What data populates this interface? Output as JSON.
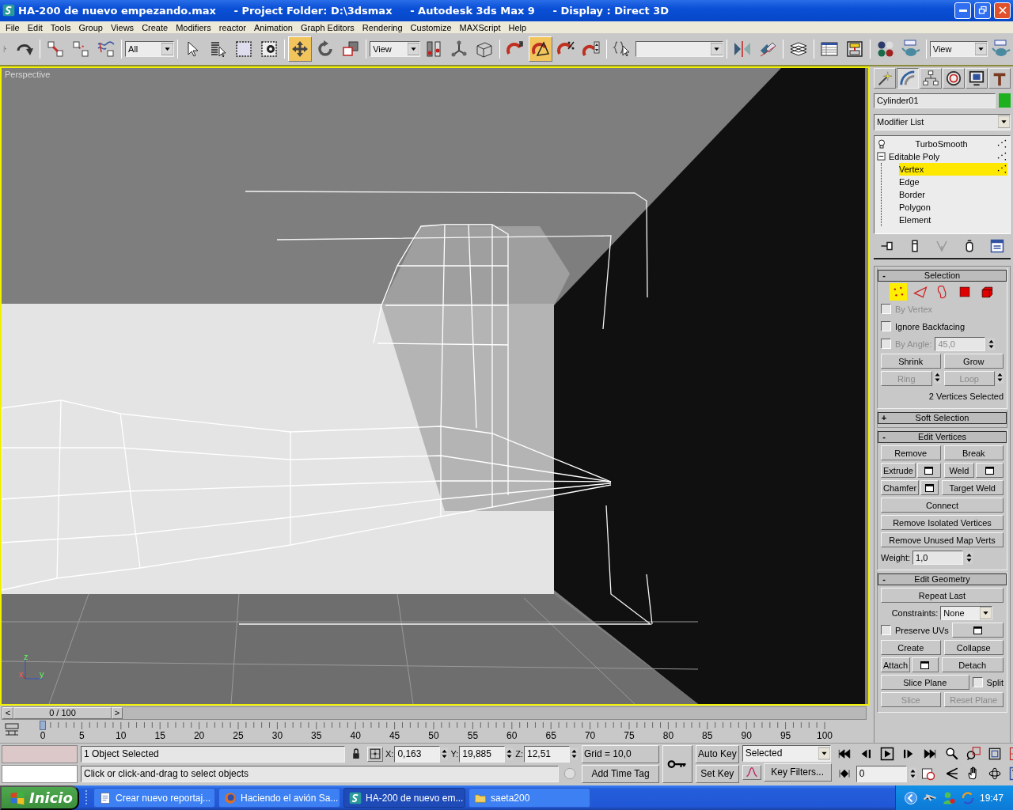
{
  "window": {
    "title": "HA-200 de nuevo empezando.max     - Project Folder: D:\\3dsmax     - Autodesk 3ds Max 9     - Display : Direct 3D"
  },
  "menu": [
    "File",
    "Edit",
    "Tools",
    "Group",
    "Views",
    "Create",
    "Modifiers",
    "reactor",
    "Animation",
    "Graph Editors",
    "Rendering",
    "Customize",
    "MAXScript",
    "Help"
  ],
  "toolbar": [
    {
      "kind": "icon",
      "selected": false
    },
    {
      "kind": "icon",
      "selected": false
    },
    {
      "kind": "icon",
      "selected": false
    },
    {
      "kind": "icon",
      "selected": false
    },
    {
      "kind": "dropdown",
      "value": "All"
    },
    {
      "kind": "icon",
      "selected": false
    },
    {
      "kind": "icon",
      "selected": false
    },
    {
      "kind": "icon",
      "selected": false
    },
    {
      "kind": "icon",
      "selected": false
    },
    {
      "kind": "icon",
      "selected": true
    },
    {
      "kind": "icon",
      "selected": false
    },
    {
      "kind": "icon",
      "selected": false
    },
    {
      "kind": "dropdown",
      "value": "View"
    },
    {
      "kind": "icon",
      "selected": false
    },
    {
      "kind": "icon",
      "selected": false
    },
    {
      "kind": "icon",
      "selected": false
    },
    {
      "kind": "icon",
      "selected": false
    },
    {
      "kind": "icon",
      "selected": true
    },
    {
      "kind": "icon",
      "selected": false
    },
    {
      "kind": "icon",
      "selected": false
    },
    {
      "kind": "icon",
      "selected": false
    },
    {
      "kind": "dropdown"
    },
    {
      "kind": "icon",
      "selected": false
    },
    {
      "kind": "icon",
      "selected": false
    },
    {
      "kind": "icon",
      "selected": false
    },
    {
      "kind": "icon",
      "selected": false
    },
    {
      "kind": "icon",
      "selected": false
    },
    {
      "kind": "icon",
      "selected": false
    },
    {
      "kind": "icon",
      "selected": false
    },
    {
      "kind": "dropdown",
      "value": "View"
    },
    {
      "kind": "icon",
      "selected": false
    }
  ],
  "viewport": {
    "label": "Perspective",
    "axis_labels": [
      "z",
      "x",
      "y"
    ]
  },
  "command_panel": {
    "tabs": [
      {
        "selected": false
      },
      {
        "selected": true
      },
      {
        "selected": false
      },
      {
        "selected": false
      },
      {
        "selected": false
      },
      {
        "selected": false
      }
    ],
    "object": {
      "name": "Cylinder01",
      "color": "#1eb01e"
    },
    "modifier_list": "Modifier List",
    "stack": [
      {
        "kind": "modifier",
        "label": "TurboSmooth",
        "selected": false
      },
      {
        "kind": "object",
        "label": "Editable Poly",
        "selected": false,
        "expanded": true,
        "children": [
          {
            "label": "Vertex",
            "selected": true
          },
          {
            "label": "Edge",
            "selected": false
          },
          {
            "label": "Border",
            "selected": false
          },
          {
            "label": "Polygon",
            "selected": false
          },
          {
            "label": "Element",
            "selected": false
          }
        ]
      }
    ],
    "rollouts": [
      {
        "sign": "-",
        "title": "Selection",
        "expanded": true,
        "rows": [
          [
            {
              "kind": "subobjects",
              "items": [
                {
                  "selected": true
                },
                {
                  "selected": false
                },
                {
                  "selected": false
                },
                {
                  "selected": false
                },
                {
                  "selected": false
                }
              ]
            }
          ],
          [
            {
              "kind": "checkbox",
              "label": "By Vertex",
              "checked": false,
              "disabled": true
            }
          ],
          [
            {
              "kind": "checkbox",
              "label": "Ignore Backfacing",
              "checked": false,
              "disabled": false
            }
          ],
          [
            {
              "kind": "checkbox",
              "label": "By Angle:",
              "checked": false,
              "disabled": true
            },
            {
              "kind": "spinner",
              "value": "45,0",
              "disabled": true
            }
          ],
          [
            {
              "kind": "button",
              "label": "Shrink",
              "disabled": false
            },
            {
              "kind": "button",
              "label": "Grow",
              "disabled": false
            }
          ],
          [
            {
              "kind": "button_spinner",
              "label": "Ring",
              "disabled": true
            },
            {
              "kind": "button_spinner",
              "label": "Loop",
              "disabled": true
            }
          ],
          [
            {
              "kind": "text",
              "text": "2 Vertices Selected"
            }
          ]
        ]
      },
      {
        "sign": "+",
        "title": "Soft Selection",
        "expanded": false
      },
      {
        "sign": "-",
        "title": "Edit Vertices",
        "expanded": true,
        "rows": [
          [
            {
              "kind": "button",
              "label": "Remove",
              "disabled": false
            },
            {
              "kind": "button",
              "label": "Break",
              "disabled": false
            }
          ],
          [
            {
              "kind": "button_settings",
              "label": "Extrude",
              "disabled": false
            },
            {
              "kind": "button_settings",
              "label": "Weld",
              "disabled": false
            }
          ],
          [
            {
              "kind": "button_settings",
              "label": "Chamfer",
              "disabled": false
            },
            {
              "kind": "button",
              "label": "Target Weld",
              "disabled": false
            }
          ],
          [
            {
              "kind": "button",
              "label": "Connect",
              "disabled": false
            }
          ],
          [
            {
              "kind": "button",
              "label": "Remove Isolated Vertices",
              "disabled": false
            }
          ],
          [
            {
              "kind": "button",
              "label": "Remove Unused Map Verts",
              "disabled": false
            }
          ],
          [
            {
              "kind": "spinner",
              "label": "Weight:",
              "value": "1,0",
              "disabled": false
            }
          ]
        ]
      },
      {
        "sign": "-",
        "title": "Edit Geometry",
        "expanded": true,
        "rows": [
          [
            {
              "kind": "button",
              "label": "Repeat Last",
              "disabled": false
            }
          ],
          [
            {
              "kind": "dropdown",
              "label": "Constraints:",
              "value": "None"
            }
          ],
          [
            {
              "kind": "checkbox",
              "label": "Preserve UVs",
              "checked": false,
              "disabled": false
            },
            {
              "kind": "settings"
            }
          ],
          [
            {
              "kind": "button",
              "label": "Create",
              "disabled": false
            },
            {
              "kind": "button",
              "label": "Collapse",
              "disabled": false
            }
          ],
          [
            {
              "kind": "button_settings",
              "label": "Attach",
              "disabled": false
            },
            {
              "kind": "button",
              "label": "Detach",
              "disabled": false
            }
          ],
          [
            {
              "kind": "button",
              "label": "Slice Plane",
              "disabled": false
            },
            {
              "kind": "checkbox",
              "label": "Split",
              "checked": false,
              "disabled": false
            }
          ],
          [
            {
              "kind": "button",
              "label": "Slice",
              "disabled": true
            },
            {
              "kind": "button",
              "label": "Reset Plane",
              "disabled": true
            }
          ]
        ]
      }
    ]
  },
  "time_slider": {
    "prev": "<",
    "position": "0 / 100",
    "next": ">"
  },
  "track_bar": {
    "ticks": [
      "0",
      "5",
      "10",
      "15",
      "20",
      "25",
      "30",
      "35",
      "40",
      "45",
      "50",
      "55",
      "60",
      "65",
      "70",
      "75",
      "80",
      "85",
      "90",
      "95",
      "100"
    ]
  },
  "status_bar": {
    "selection": "1 Object Selected",
    "prompt": "Click or click-and-drag to select objects",
    "coordinates": [
      {
        "label": "X:",
        "value": "0,163"
      },
      {
        "label": "Y:",
        "value": "19,885"
      },
      {
        "label": "Z:",
        "value": "12,51"
      }
    ],
    "grid": "Grid = 10,0",
    "time_tag": "Add Time Tag",
    "auto_key": "Auto Key",
    "set_key": "Set Key",
    "key_mode": "Selected",
    "key_filters": "Key Filters...",
    "frame": "0"
  },
  "taskbar": {
    "start": "Inicio",
    "tasks": [
      {
        "label": "Crear nuevo reportaj...",
        "selected": false
      },
      {
        "label": "Haciendo el avión Sa...",
        "selected": false
      },
      {
        "label": "HA-200 de nuevo em...",
        "selected": true
      },
      {
        "label": "saeta200",
        "selected": false
      }
    ],
    "clock": "19:47"
  }
}
